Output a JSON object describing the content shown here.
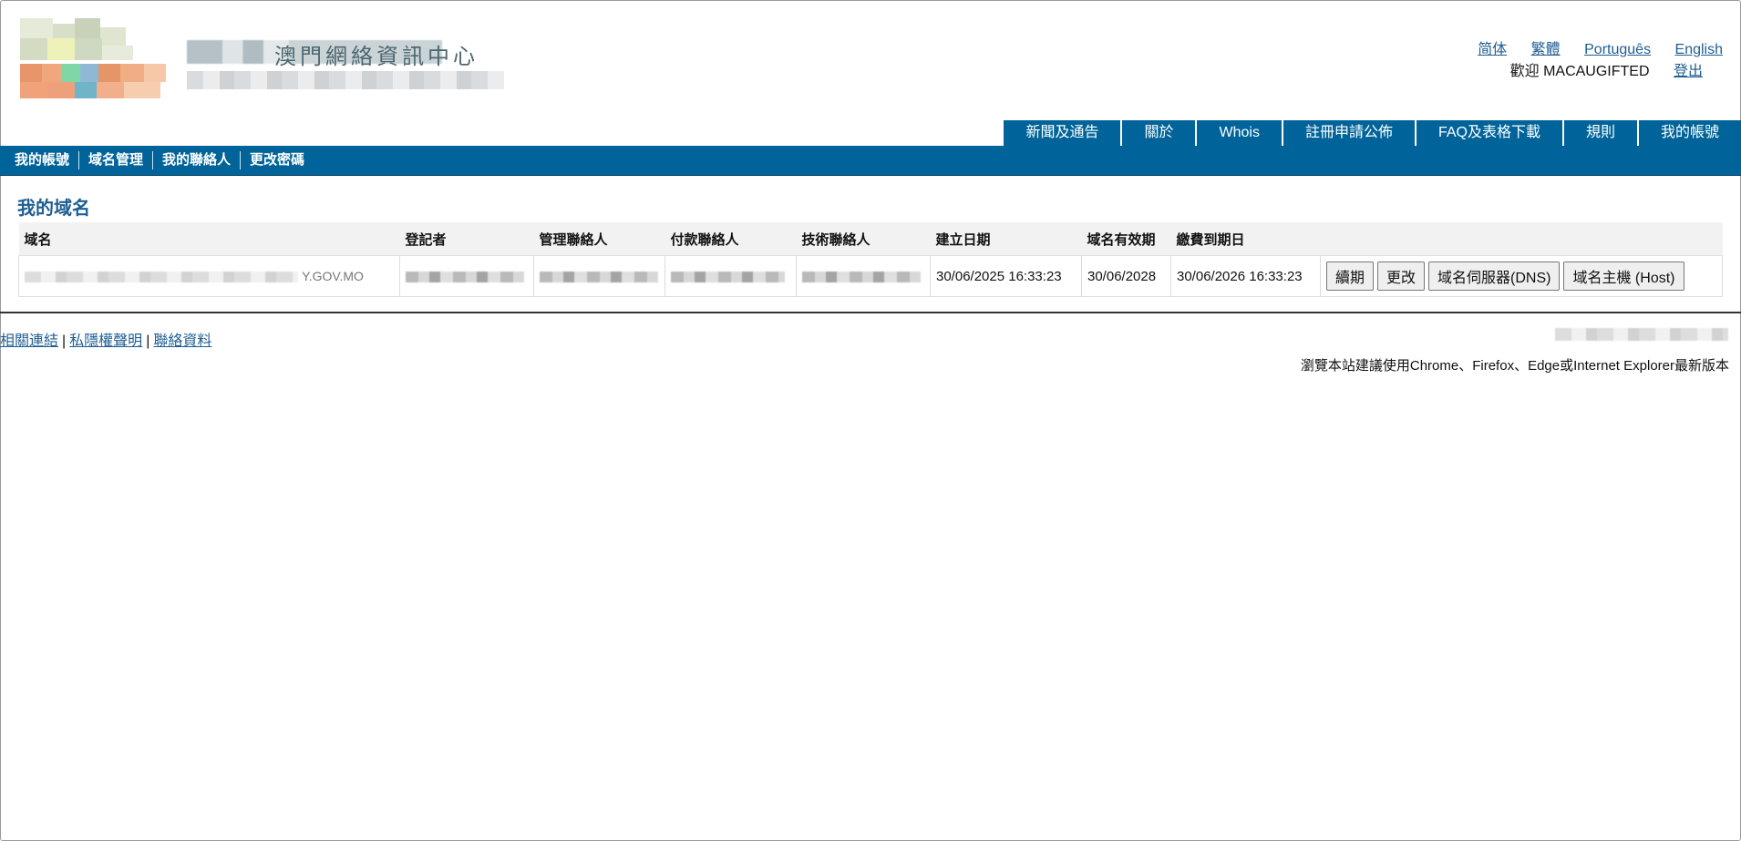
{
  "header": {
    "title_partial": "澳門網絡資訊中心",
    "languages": [
      "简体",
      "繁體",
      "Português",
      "English"
    ],
    "welcome_label": "歡迎",
    "username": "MACAUGIFTED",
    "logout_label": "登出"
  },
  "topnav": [
    "新聞及通告",
    "關於",
    "Whois",
    "註冊申請公佈",
    "FAQ及表格下載",
    "規則",
    "我的帳號"
  ],
  "subnav": [
    "我的帳號",
    "域名管理",
    "我的聯絡人",
    "更改密碼"
  ],
  "main": {
    "title": "我的域名",
    "columns": [
      "域名",
      "登記者",
      "管理聯絡人",
      "付款聯絡人",
      "技術聯絡人",
      "建立日期",
      "域名有效期",
      "繳費到期日"
    ],
    "row": {
      "domain_visible_suffix": "Y.GOV.MO",
      "created": "30/06/2025 16:33:23",
      "valid_until": "30/06/2028",
      "payment_due": "30/06/2026 16:33:23"
    },
    "actions": [
      "續期",
      "更改",
      "域名伺服器(DNS)",
      "域名主機 (Host)"
    ]
  },
  "footer": {
    "links": [
      "相關連結",
      "私隱權聲明",
      "聯絡資料"
    ],
    "browser_note": "瀏覽本站建議使用Chrome、Firefox、Edge或Internet Explorer最新版本"
  }
}
